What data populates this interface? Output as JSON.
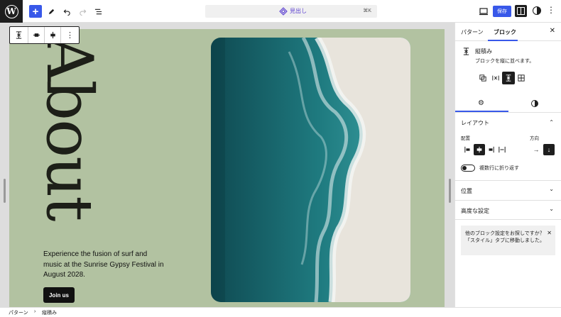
{
  "toolbar": {
    "command_label": "見出し",
    "command_shortcut": "⌘K",
    "save_label": "保存"
  },
  "canvas": {
    "heading": "About",
    "blurb": "Experience the fusion of surf and music at the Sunrise Gypsy Festival in August 2028.",
    "button_label": "Join us",
    "background_color": "#b2c2a1"
  },
  "sidebar": {
    "tabs": [
      "パターン",
      "ブロック"
    ],
    "block_title": "縦積み",
    "block_description": "ブロックを縦に並べます。",
    "layout_title": "レイアウト",
    "justify_label": "配置",
    "orientation_label": "方向",
    "wrap_label": "複数行に折り返す",
    "position_title": "位置",
    "advanced_title": "高度な設定",
    "notice_text": "他のブロック設定をお探しですか？「スタイル」タブに移動しました。"
  },
  "breadcrumb": [
    "パターン",
    "縦積み"
  ],
  "colors": {
    "accent": "#3858e9",
    "dark": "#1e1e1e"
  }
}
